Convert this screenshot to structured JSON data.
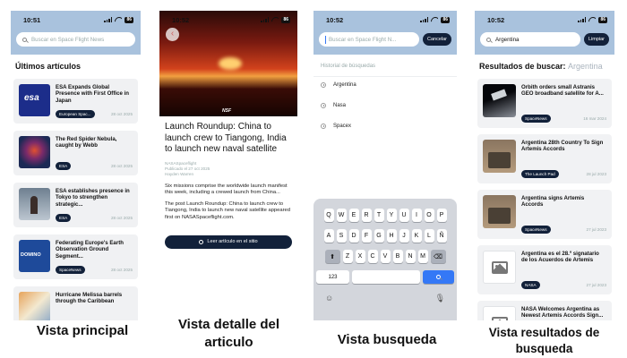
{
  "status_time_1": "10:51",
  "status_time_2": "10:52",
  "status_time_3": "10:52",
  "status_time_4": "10:52",
  "battery": "86",
  "main": {
    "search_placeholder": "Buscar en Space Flight News",
    "section_title": "Últimos artículos",
    "articles": [
      {
        "title": "ESA Expands Global Presence with First Office in Japan",
        "source": "European Spac...",
        "date": "28 oct 2025",
        "thumb_text": "esa"
      },
      {
        "title": "The Red Spider Nebula, caught by Webb",
        "source": "ESA",
        "date": "28 oct 2025"
      },
      {
        "title": "ESA establishes presence in Tokyo to strengthen strategic...",
        "source": "ESA",
        "date": "28 oct 2025"
      },
      {
        "title": "Federating Europe's Earth Observation Ground Segment...",
        "source": "SpaceNews",
        "date": "28 oct 2025",
        "thumb_text": "DOMINO"
      },
      {
        "title": "Hurricane Melissa barrels through the Caribbean",
        "source": "",
        "date": ""
      }
    ]
  },
  "detail": {
    "back_icon": "chevron-left-icon",
    "image_credit": "NSF",
    "title": "Launch Roundup: China to launch crew to Tiangong, India to launch new naval satellite",
    "source": "NASASpaceflight",
    "published": "Publicado el 27 oct 2025",
    "author": "Hayden Warren",
    "summary": "Six missions comprise the worldwide launch manifest this week, including a crewed launch from China...",
    "body": "The post Launch Roundup: China to launch crew to Tiangong, India to launch new naval satellite appeared first on NASASpaceflight.com.",
    "read_button": "Leer artículo en el sitio"
  },
  "search": {
    "placeholder": "Buscar en Space Flight N...",
    "cancel": "Cancelar",
    "history_label": "Historial de búsquedas",
    "history": [
      "Argentina",
      "Nasa",
      "Spacex"
    ],
    "keyboard": {
      "row1": [
        "Q",
        "W",
        "E",
        "R",
        "T",
        "Y",
        "U",
        "I",
        "O",
        "P"
      ],
      "row2": [
        "A",
        "S",
        "D",
        "F",
        "G",
        "H",
        "J",
        "K",
        "L",
        "Ñ"
      ],
      "row3": [
        "Z",
        "X",
        "C",
        "V",
        "B",
        "N",
        "M"
      ],
      "num_key": "123"
    }
  },
  "results": {
    "query": "Argentina",
    "clear": "Limpiar",
    "title_prefix": "Resultados de buscar:",
    "title_query": "Argentina",
    "items": [
      {
        "title": "Orbith orders small Astranis GEO broadband satellite for A...",
        "source": "SpaceNews",
        "date": "16 mar 2024"
      },
      {
        "title": "Argentina 28th Country To Sign Artemis Accords",
        "source": "The Launch Pad",
        "date": "28 jul 2023"
      },
      {
        "title": "Argentina signs Artemis Accords",
        "source": "SpaceNews",
        "date": "27 jul 2023"
      },
      {
        "title": "Argentina es el 28.º signatario de los Acuerdos de Artemis",
        "source": "NASA",
        "date": "27 jul 2023"
      },
      {
        "title": "NASA Welcomes Argentina as Newest Artemis Accords Sign...",
        "source": "",
        "date": ""
      }
    ]
  },
  "captions": {
    "main": "Vista principal",
    "detail": "Vista detalle del articulo",
    "search": "Vista busqueda",
    "results": "Vista resultados de busqueda"
  }
}
